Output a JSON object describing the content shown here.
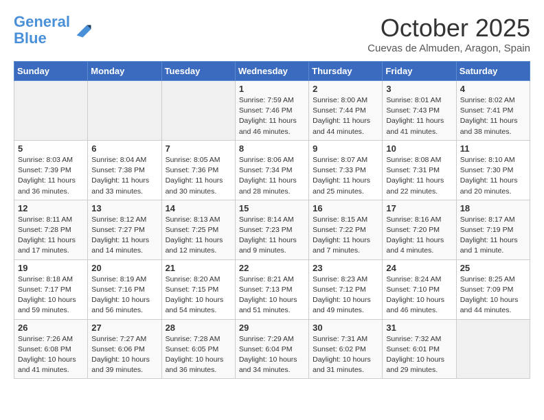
{
  "header": {
    "logo_line1": "General",
    "logo_line2": "Blue",
    "month_title": "October 2025",
    "subtitle": "Cuevas de Almuden, Aragon, Spain"
  },
  "weekdays": [
    "Sunday",
    "Monday",
    "Tuesday",
    "Wednesday",
    "Thursday",
    "Friday",
    "Saturday"
  ],
  "weeks": [
    [
      {
        "day": "",
        "info": ""
      },
      {
        "day": "",
        "info": ""
      },
      {
        "day": "",
        "info": ""
      },
      {
        "day": "1",
        "info": "Sunrise: 7:59 AM\nSunset: 7:46 PM\nDaylight: 11 hours and 46 minutes."
      },
      {
        "day": "2",
        "info": "Sunrise: 8:00 AM\nSunset: 7:44 PM\nDaylight: 11 hours and 44 minutes."
      },
      {
        "day": "3",
        "info": "Sunrise: 8:01 AM\nSunset: 7:43 PM\nDaylight: 11 hours and 41 minutes."
      },
      {
        "day": "4",
        "info": "Sunrise: 8:02 AM\nSunset: 7:41 PM\nDaylight: 11 hours and 38 minutes."
      }
    ],
    [
      {
        "day": "5",
        "info": "Sunrise: 8:03 AM\nSunset: 7:39 PM\nDaylight: 11 hours and 36 minutes."
      },
      {
        "day": "6",
        "info": "Sunrise: 8:04 AM\nSunset: 7:38 PM\nDaylight: 11 hours and 33 minutes."
      },
      {
        "day": "7",
        "info": "Sunrise: 8:05 AM\nSunset: 7:36 PM\nDaylight: 11 hours and 30 minutes."
      },
      {
        "day": "8",
        "info": "Sunrise: 8:06 AM\nSunset: 7:34 PM\nDaylight: 11 hours and 28 minutes."
      },
      {
        "day": "9",
        "info": "Sunrise: 8:07 AM\nSunset: 7:33 PM\nDaylight: 11 hours and 25 minutes."
      },
      {
        "day": "10",
        "info": "Sunrise: 8:08 AM\nSunset: 7:31 PM\nDaylight: 11 hours and 22 minutes."
      },
      {
        "day": "11",
        "info": "Sunrise: 8:10 AM\nSunset: 7:30 PM\nDaylight: 11 hours and 20 minutes."
      }
    ],
    [
      {
        "day": "12",
        "info": "Sunrise: 8:11 AM\nSunset: 7:28 PM\nDaylight: 11 hours and 17 minutes."
      },
      {
        "day": "13",
        "info": "Sunrise: 8:12 AM\nSunset: 7:27 PM\nDaylight: 11 hours and 14 minutes."
      },
      {
        "day": "14",
        "info": "Sunrise: 8:13 AM\nSunset: 7:25 PM\nDaylight: 11 hours and 12 minutes."
      },
      {
        "day": "15",
        "info": "Sunrise: 8:14 AM\nSunset: 7:23 PM\nDaylight: 11 hours and 9 minutes."
      },
      {
        "day": "16",
        "info": "Sunrise: 8:15 AM\nSunset: 7:22 PM\nDaylight: 11 hours and 7 minutes."
      },
      {
        "day": "17",
        "info": "Sunrise: 8:16 AM\nSunset: 7:20 PM\nDaylight: 11 hours and 4 minutes."
      },
      {
        "day": "18",
        "info": "Sunrise: 8:17 AM\nSunset: 7:19 PM\nDaylight: 11 hours and 1 minute."
      }
    ],
    [
      {
        "day": "19",
        "info": "Sunrise: 8:18 AM\nSunset: 7:17 PM\nDaylight: 10 hours and 59 minutes."
      },
      {
        "day": "20",
        "info": "Sunrise: 8:19 AM\nSunset: 7:16 PM\nDaylight: 10 hours and 56 minutes."
      },
      {
        "day": "21",
        "info": "Sunrise: 8:20 AM\nSunset: 7:15 PM\nDaylight: 10 hours and 54 minutes."
      },
      {
        "day": "22",
        "info": "Sunrise: 8:21 AM\nSunset: 7:13 PM\nDaylight: 10 hours and 51 minutes."
      },
      {
        "day": "23",
        "info": "Sunrise: 8:23 AM\nSunset: 7:12 PM\nDaylight: 10 hours and 49 minutes."
      },
      {
        "day": "24",
        "info": "Sunrise: 8:24 AM\nSunset: 7:10 PM\nDaylight: 10 hours and 46 minutes."
      },
      {
        "day": "25",
        "info": "Sunrise: 8:25 AM\nSunset: 7:09 PM\nDaylight: 10 hours and 44 minutes."
      }
    ],
    [
      {
        "day": "26",
        "info": "Sunrise: 7:26 AM\nSunset: 6:08 PM\nDaylight: 10 hours and 41 minutes."
      },
      {
        "day": "27",
        "info": "Sunrise: 7:27 AM\nSunset: 6:06 PM\nDaylight: 10 hours and 39 minutes."
      },
      {
        "day": "28",
        "info": "Sunrise: 7:28 AM\nSunset: 6:05 PM\nDaylight: 10 hours and 36 minutes."
      },
      {
        "day": "29",
        "info": "Sunrise: 7:29 AM\nSunset: 6:04 PM\nDaylight: 10 hours and 34 minutes."
      },
      {
        "day": "30",
        "info": "Sunrise: 7:31 AM\nSunset: 6:02 PM\nDaylight: 10 hours and 31 minutes."
      },
      {
        "day": "31",
        "info": "Sunrise: 7:32 AM\nSunset: 6:01 PM\nDaylight: 10 hours and 29 minutes."
      },
      {
        "day": "",
        "info": ""
      }
    ]
  ]
}
